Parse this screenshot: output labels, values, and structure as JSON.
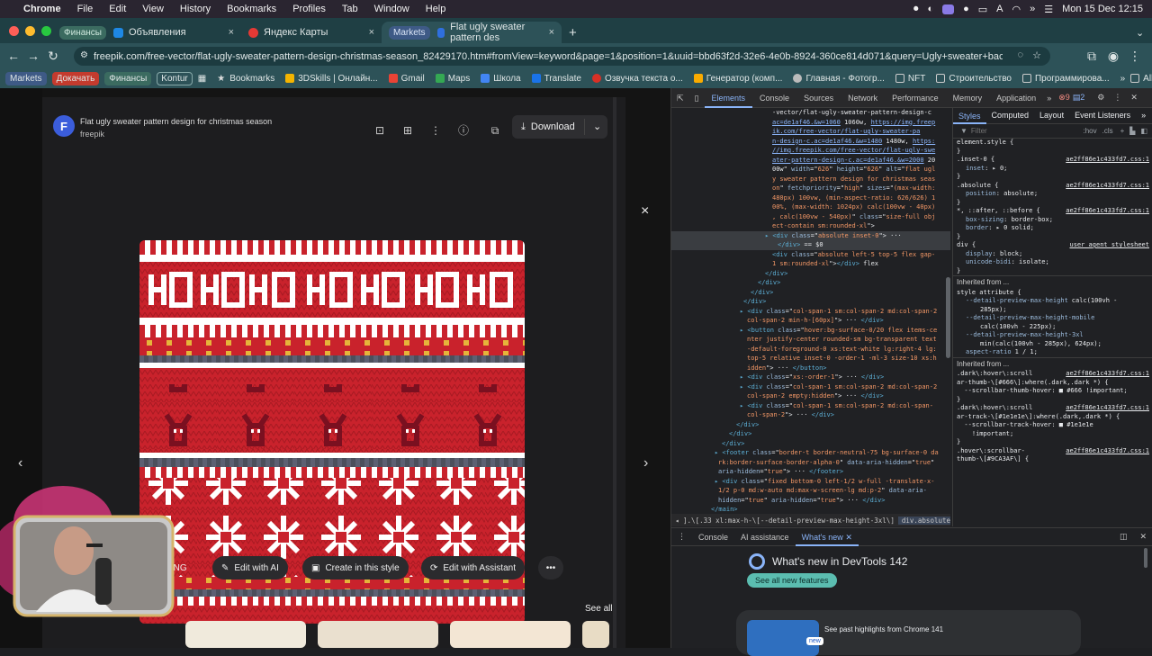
{
  "menubar": {
    "app": "Chrome",
    "items": [
      "File",
      "Edit",
      "View",
      "History",
      "Bookmarks",
      "Profiles",
      "Tab",
      "Window",
      "Help"
    ],
    "clock": "Mon 15 Dec  12:15"
  },
  "tabs": [
    {
      "tag": "Финансы",
      "label": "Объявления",
      "close": "×"
    },
    {
      "label": "Яндекс Карты",
      "close": "×"
    },
    {
      "tag": "Markets",
      "label": "Flat ugly sweater pattern des",
      "close": "×",
      "active": true
    }
  ],
  "new_tab": "+",
  "omnibox": {
    "url": "freepik.com/free-vector/flat-ugly-sweater-pattern-design-christmas-season_82429170.htm#fromView=keyword&page=1&position=1&uuid=bbd63f2d-32e6-4e0b-8924-360ce814d071&query=Ugly+sweater+background"
  },
  "bookmarks": {
    "tags": [
      "Markets",
      "Докачать",
      "Финансы",
      "Kontur"
    ],
    "items": [
      "Bookmarks",
      "3DSkills | Онлайн...",
      "Gmail",
      "Maps",
      "Школа",
      "Translate",
      "Озвучка текста о...",
      "Генератор (комп...",
      "Главная - Фотогр...",
      "NFT",
      "Строительство",
      "Программирова..."
    ],
    "all": "All Bookmarks"
  },
  "preview": {
    "title": "Flat ugly sweater pattern design for christmas season",
    "author": "freepik",
    "download": "Download",
    "close": "×",
    "prev": "‹",
    "next": "›",
    "actions": [
      "PNG",
      "Edit with AI",
      "Create in this style",
      "Edit with Assistant"
    ],
    "more": "•••",
    "see_all": "See all"
  },
  "devtools": {
    "tabs": [
      "Elements",
      "Console",
      "Sources",
      "Network",
      "Performance",
      "Memory",
      "Application"
    ],
    "active_tab": "Elements",
    "errors": "9",
    "warnings": "2",
    "styles_tabs": [
      "Styles",
      "Computed",
      "Layout",
      "Event Listeners"
    ],
    "filter_placeholder": "Filter",
    "filter_hov": ":hov",
    "filter_cls": ".cls",
    "elements_lines": [
      {
        "indent": 112,
        "parts": [
          {
            "c": "tx",
            "t": "-vector/flat-ugly-sweater-pattern-design-c"
          }
        ]
      },
      {
        "indent": 112,
        "parts": [
          {
            "c": "lk",
            "t": "ac=de1af46.&w=1060"
          },
          {
            "c": "tx",
            "t": " 1060w, "
          },
          {
            "c": "lk",
            "t": "https://img.freep"
          }
        ]
      },
      {
        "indent": 112,
        "parts": [
          {
            "c": "lk",
            "t": "ik.com/free-vector/flat-ugly-sweater-pa"
          }
        ]
      },
      {
        "indent": 112,
        "parts": [
          {
            "c": "lk",
            "t": "n-design-c.ac=de1af46.&w=1480"
          },
          {
            "c": "tx",
            "t": " 1480w, "
          },
          {
            "c": "lk",
            "t": "https:"
          }
        ]
      },
      {
        "indent": 112,
        "parts": [
          {
            "c": "lk",
            "t": "//img.freepik.com/free-vector/flat-ugly-swe"
          }
        ]
      },
      {
        "indent": 112,
        "parts": [
          {
            "c": "lk",
            "t": "ater-pattern-design-c.ac=de1af46.&w=2000"
          },
          {
            "c": "tx",
            "t": " 20"
          }
        ]
      },
      {
        "indent": 112,
        "parts": [
          {
            "c": "tx",
            "t": "00w\" "
          },
          {
            "c": "at",
            "t": "width"
          },
          {
            "c": "tx",
            "t": "=\""
          },
          {
            "c": "av",
            "t": "626"
          },
          {
            "c": "tx",
            "t": "\" "
          },
          {
            "c": "at",
            "t": "height"
          },
          {
            "c": "tx",
            "t": "=\""
          },
          {
            "c": "av",
            "t": "626"
          },
          {
            "c": "tx",
            "t": "\" "
          },
          {
            "c": "at",
            "t": "alt"
          },
          {
            "c": "tx",
            "t": "=\""
          },
          {
            "c": "av",
            "t": "flat ugl"
          }
        ]
      },
      {
        "indent": 112,
        "parts": [
          {
            "c": "av",
            "t": "y sweater pattern design for christmas seas"
          }
        ]
      },
      {
        "indent": 112,
        "parts": [
          {
            "c": "av",
            "t": "on"
          },
          {
            "c": "tx",
            "t": "\" "
          },
          {
            "c": "at",
            "t": "fetchpriority"
          },
          {
            "c": "tx",
            "t": "=\""
          },
          {
            "c": "av",
            "t": "high"
          },
          {
            "c": "tx",
            "t": "\" "
          },
          {
            "c": "at",
            "t": "sizes"
          },
          {
            "c": "tx",
            "t": "=\""
          },
          {
            "c": "av",
            "t": "(max-width:"
          }
        ]
      },
      {
        "indent": 112,
        "parts": [
          {
            "c": "av",
            "t": "480px) 100vw, (min-aspect-ratio: 626/626) 1"
          }
        ]
      },
      {
        "indent": 112,
        "parts": [
          {
            "c": "av",
            "t": "00%, (max-width: 1024px) calc(100vw - 40px)"
          }
        ]
      },
      {
        "indent": 112,
        "parts": [
          {
            "c": "av",
            "t": ", calc(100vw - 540px)"
          },
          {
            "c": "tx",
            "t": "\" "
          },
          {
            "c": "at",
            "t": "class"
          },
          {
            "c": "tx",
            "t": "=\""
          },
          {
            "c": "av",
            "t": "size-full obj"
          }
        ]
      },
      {
        "indent": 112,
        "parts": [
          {
            "c": "av",
            "t": "ect-contain sm:rounded-xl"
          },
          {
            "c": "tx",
            "t": "\">"
          }
        ]
      },
      {
        "indent": 104,
        "sel": true,
        "parts": [
          {
            "c": "tg",
            "t": "▸ <div "
          },
          {
            "c": "at",
            "t": "class"
          },
          {
            "c": "tx",
            "t": "=\""
          },
          {
            "c": "av",
            "t": "absolute inset-0"
          },
          {
            "c": "tx",
            "t": "\">"
          },
          {
            "c": "tx",
            "t": " ··· "
          }
        ]
      },
      {
        "indent": 118,
        "sel": true,
        "parts": [
          {
            "c": "tg",
            "t": "</div>"
          },
          {
            "c": "tx",
            "t": " == $0"
          }
        ]
      },
      {
        "indent": 112,
        "parts": [
          {
            "c": "tg",
            "t": "<div "
          },
          {
            "c": "at",
            "t": "class"
          },
          {
            "c": "tx",
            "t": "=\""
          },
          {
            "c": "av",
            "t": "absolute left-5 top-5 flex gap-"
          }
        ]
      },
      {
        "indent": 112,
        "parts": [
          {
            "c": "av",
            "t": "1 sm:rounded-xl"
          },
          {
            "c": "tx",
            "t": "\">"
          },
          {
            "c": "tg",
            "t": "</div>"
          },
          {
            "c": "tx",
            "t": " flex"
          }
        ]
      },
      {
        "indent": 104,
        "parts": [
          {
            "c": "tg",
            "t": "</div>"
          }
        ]
      },
      {
        "indent": 96,
        "parts": [
          {
            "c": "tg",
            "t": "</div>"
          }
        ]
      },
      {
        "indent": 88,
        "parts": [
          {
            "c": "tg",
            "t": "</div>"
          }
        ]
      },
      {
        "indent": 80,
        "parts": [
          {
            "c": "tg",
            "t": "</div>"
          }
        ]
      },
      {
        "indent": 76,
        "parts": [
          {
            "c": "tg",
            "t": "▸ <div "
          },
          {
            "c": "at",
            "t": "class"
          },
          {
            "c": "tx",
            "t": "=\""
          },
          {
            "c": "av",
            "t": "col-span-1 sm:col-span-2 md:col-span-2"
          }
        ]
      },
      {
        "indent": 84,
        "parts": [
          {
            "c": "av",
            "t": "col-span-2 min-h-[60px]"
          },
          {
            "c": "tx",
            "t": "\"> ··· "
          },
          {
            "c": "tg",
            "t": "</div>"
          }
        ]
      },
      {
        "indent": 76,
        "parts": [
          {
            "c": "tg",
            "t": "▸ <button "
          },
          {
            "c": "at",
            "t": "class"
          },
          {
            "c": "tx",
            "t": "=\""
          },
          {
            "c": "av",
            "t": "hover:bg-surface-0/20 flex items-ce"
          }
        ]
      },
      {
        "indent": 84,
        "parts": [
          {
            "c": "av",
            "t": "nter justify-center rounded-sm bg-transparent text"
          }
        ]
      },
      {
        "indent": 84,
        "parts": [
          {
            "c": "av",
            "t": "-default-foreground-0 xs:text-white lg:right-4 lg:"
          }
        ]
      },
      {
        "indent": 84,
        "parts": [
          {
            "c": "av",
            "t": "top-5 relative inset-0 -order-1 -ml-3 size-10 xs:h"
          }
        ]
      },
      {
        "indent": 84,
        "parts": [
          {
            "c": "av",
            "t": "idden"
          },
          {
            "c": "tx",
            "t": "\"> ··· "
          },
          {
            "c": "tg",
            "t": "</button>"
          }
        ]
      },
      {
        "indent": 76,
        "parts": [
          {
            "c": "tg",
            "t": "▸ <div "
          },
          {
            "c": "at",
            "t": "class"
          },
          {
            "c": "tx",
            "t": "=\""
          },
          {
            "c": "av",
            "t": "xs:-order-1"
          },
          {
            "c": "tx",
            "t": "\"> ··· "
          },
          {
            "c": "tg",
            "t": "</div>"
          }
        ]
      },
      {
        "indent": 76,
        "parts": [
          {
            "c": "tg",
            "t": "▸ <div "
          },
          {
            "c": "at",
            "t": "class"
          },
          {
            "c": "tx",
            "t": "=\""
          },
          {
            "c": "av",
            "t": "col-span-1 sm:col-span-2 md:col-span-2"
          }
        ]
      },
      {
        "indent": 84,
        "parts": [
          {
            "c": "av",
            "t": "col-span-2 empty:hidden"
          },
          {
            "c": "tx",
            "t": "\"> ··· "
          },
          {
            "c": "tg",
            "t": "</div>"
          }
        ]
      },
      {
        "indent": 76,
        "parts": [
          {
            "c": "tg",
            "t": "▸ <div "
          },
          {
            "c": "at",
            "t": "class"
          },
          {
            "c": "tx",
            "t": "=\""
          },
          {
            "c": "av",
            "t": "col-span-1 sm:col-span-2 md:col-span-"
          }
        ]
      },
      {
        "indent": 84,
        "parts": [
          {
            "c": "av",
            "t": "col-span-2"
          },
          {
            "c": "tx",
            "t": "\"> ··· "
          },
          {
            "c": "tg",
            "t": "</div>"
          }
        ]
      },
      {
        "indent": 72,
        "parts": [
          {
            "c": "tg",
            "t": "</div>"
          }
        ]
      },
      {
        "indent": 64,
        "parts": [
          {
            "c": "tg",
            "t": "</div>"
          }
        ]
      },
      {
        "indent": 56,
        "parts": [
          {
            "c": "tg",
            "t": "</div>"
          }
        ]
      },
      {
        "indent": 48,
        "parts": [
          {
            "c": "tg",
            "t": "▸ <footer "
          },
          {
            "c": "at",
            "t": "class"
          },
          {
            "c": "tx",
            "t": "=\""
          },
          {
            "c": "av",
            "t": "border-t border-neutral-75 bg-surface-0 da"
          }
        ]
      },
      {
        "indent": 52,
        "parts": [
          {
            "c": "av",
            "t": "rk:border-surface-border-alpha-0"
          },
          {
            "c": "tx",
            "t": "\" "
          },
          {
            "c": "at",
            "t": "data-aria-hidden"
          },
          {
            "c": "tx",
            "t": "=\""
          },
          {
            "c": "av",
            "t": "true"
          },
          {
            "c": "tx",
            "t": "\""
          }
        ]
      },
      {
        "indent": 52,
        "parts": [
          {
            "c": "at",
            "t": "aria-hidden"
          },
          {
            "c": "tx",
            "t": "=\""
          },
          {
            "c": "av",
            "t": "true"
          },
          {
            "c": "tx",
            "t": "\"> ··· "
          },
          {
            "c": "tg",
            "t": "</footer>"
          }
        ]
      },
      {
        "indent": 48,
        "parts": [
          {
            "c": "tg",
            "t": "▸ <div "
          },
          {
            "c": "at",
            "t": "class"
          },
          {
            "c": "tx",
            "t": "=\""
          },
          {
            "c": "av",
            "t": "fixed bottom-0 left-1/2 w-full -translate-x-"
          }
        ]
      },
      {
        "indent": 52,
        "parts": [
          {
            "c": "av",
            "t": "1/2 p-0 md:w-auto md:max-w-screen-lg md:p-2"
          },
          {
            "c": "tx",
            "t": "\" "
          },
          {
            "c": "at",
            "t": "data-aria-"
          }
        ]
      },
      {
        "indent": 52,
        "parts": [
          {
            "c": "at",
            "t": "hidden"
          },
          {
            "c": "tx",
            "t": "=\""
          },
          {
            "c": "av",
            "t": "true"
          },
          {
            "c": "tx",
            "t": "\" "
          },
          {
            "c": "at",
            "t": "aria-hidden"
          },
          {
            "c": "tx",
            "t": "=\""
          },
          {
            "c": "av",
            "t": "true"
          },
          {
            "c": "tx",
            "t": "\"> ··· "
          },
          {
            "c": "tg",
            "t": "</div>"
          }
        ]
      },
      {
        "indent": 44,
        "parts": [
          {
            "c": "tg",
            "t": "</main>"
          }
        ]
      },
      {
        "indent": 40,
        "parts": [
          {
            "c": "tg",
            "t": "</div>"
          }
        ]
      }
    ],
    "crumbs": [
      "◂ ].\\[.33 xl:max-h-\\[--detail-preview-max-height-3xl\\]",
      "div.absolute.inset-0"
    ],
    "styles": [
      {
        "sel": "element.style {",
        "rules": [],
        "src": ""
      },
      {
        "sel": ".inset-0 {",
        "rules": [
          [
            "inset",
            "▸ 0;"
          ]
        ],
        "src": "ae2ff86e1c433fd7.css:1"
      },
      {
        "sel": ".absolute {",
        "rules": [
          [
            "position",
            "absolute;"
          ]
        ],
        "src": "ae2ff86e1c433fd7.css:1"
      },
      {
        "sel": "*, ::after, ::before {",
        "rules": [
          [
            "box-sizing",
            "border-box;"
          ],
          [
            "border",
            "▸ 0 solid;"
          ]
        ],
        "src": "ae2ff86e1c433fd7.css:1"
      },
      {
        "sel": "div {",
        "rules": [
          [
            "display",
            "block;"
          ],
          [
            "unicode-bidi",
            "isolate;"
          ]
        ],
        "src": "user agent stylesheet"
      }
    ],
    "inherited1": "Inherited from ...",
    "style_attr": "style attribute {",
    "style_attr_rules": [
      [
        "--detail-preview-max-height",
        "calc(100vh -"
      ],
      [
        "",
        "285px);"
      ],
      [
        "--detail-preview-max-height-mobile",
        ""
      ],
      [
        "",
        "calc(100vh - 225px);"
      ],
      [
        "--detail-preview-max-height-3xl",
        ""
      ],
      [
        "",
        "min(calc(100vh - 285px), 624px);"
      ],
      [
        "aspect-ratio",
        "1 / 1;"
      ]
    ],
    "inherited2": "Inherited from ...",
    "scroll_rules": [
      {
        "sel": ".dark\\:hover\\:scroll",
        "src": "ae2ff86e1c433fd7.css:1"
      },
      {
        "sel": "ar-thumb-\\[#666\\]:where(.dark,.dark *) {",
        "src": ""
      },
      {
        "sel": "  --scrollbar-thumb-hover: ■ #666 !important;",
        "src": ""
      },
      {
        "sel": "}",
        "src": ""
      },
      {
        "sel": ".dark\\:hover\\:scroll",
        "src": "ae2ff86e1c433fd7.css:1"
      },
      {
        "sel": "ar-track-\\[#1e1e1e\\]:where(.dark,.dark *) {",
        "src": ""
      },
      {
        "sel": "  --scrollbar-track-hover: ■ #1e1e1e",
        "src": ""
      },
      {
        "sel": "    !important;",
        "src": ""
      },
      {
        "sel": "}",
        "src": ""
      },
      {
        "sel": ".hover\\:scrollbar-",
        "src": "ae2ff86e1c433fd7.css:1"
      },
      {
        "sel": "thumb-\\[#9CA3AF\\] {",
        "src": ""
      }
    ],
    "drawer_tabs": [
      "Console",
      "AI assistance",
      "What's new"
    ],
    "drawer_active": "What's new",
    "whats_new_title": "What's new in DevTools 142",
    "whats_new_button": "See all new features",
    "whats_new_card": "See past highlights from Chrome 141",
    "whats_new_badge": "new"
  }
}
